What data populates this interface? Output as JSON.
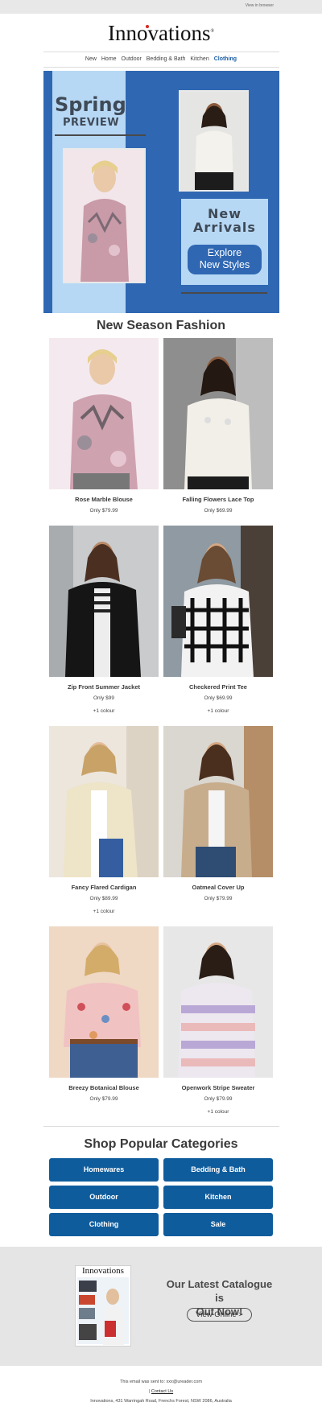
{
  "topbar": {
    "view_in_browser": "View in browser"
  },
  "logo": {
    "text": "Innovations",
    "tm": "®"
  },
  "nav": {
    "items": [
      "New",
      "Home",
      "Outdoor",
      "Bedding & Bath",
      "Kitchen",
      "Clothing"
    ],
    "active": "Clothing"
  },
  "hero": {
    "headline_1": "Spring",
    "headline_2": "PREVIEW",
    "new_arrivals_1": "New",
    "new_arrivals_2": "Arrivals",
    "cta_line_1": "Explore",
    "cta_line_2": "New Styles"
  },
  "new_season": {
    "title": "New Season Fashion",
    "products": [
      {
        "name": "Rose Marble Blouse",
        "price": "Only $79.99",
        "colour": ""
      },
      {
        "name": "Falling Flowers Lace Top",
        "price": "Only $69.99",
        "colour": ""
      },
      {
        "name": "Zip Front Summer Jacket",
        "price": "Only $99",
        "colour": "+1 colour"
      },
      {
        "name": "Checkered Print Tee",
        "price": "Only $69.99",
        "colour": "+1 colour"
      },
      {
        "name": "Fancy Flared Cardigan",
        "price": "Only $89.99",
        "colour": "+1 colour"
      },
      {
        "name": "Oatmeal Cover Up",
        "price": "Only $79.99",
        "colour": ""
      },
      {
        "name": "Breezy Botanical Blouse",
        "price": "Only $79.99",
        "colour": ""
      },
      {
        "name": "Openwork Stripe Sweater",
        "price": "Only $79.99",
        "colour": "+1 colour"
      }
    ]
  },
  "categories": {
    "title": "Shop Popular Categories",
    "buttons": [
      "Homewares",
      "Bedding & Bath",
      "Outdoor",
      "Kitchen",
      "Clothing",
      "Sale"
    ]
  },
  "catalogue": {
    "cover_title": "Innovations",
    "heading_1": "Our Latest Catalogue is",
    "heading_2": "Out Now!",
    "button": "View Online >"
  },
  "footer": {
    "sent_to": "This email was sent to: xxx@ureader.com",
    "separator": "|",
    "contact": "Contact Us",
    "address": "Innovations, 431 Warringah Road, Frenchs Forest, NSW 2086, Australia"
  },
  "colors": {
    "hero_blue": "#2f67b2",
    "hero_light_blue": "#b7d8f5",
    "category_button": "#0f5c9c",
    "nav_active": "#1c5fa8",
    "logo_dot": "#d7261e"
  }
}
